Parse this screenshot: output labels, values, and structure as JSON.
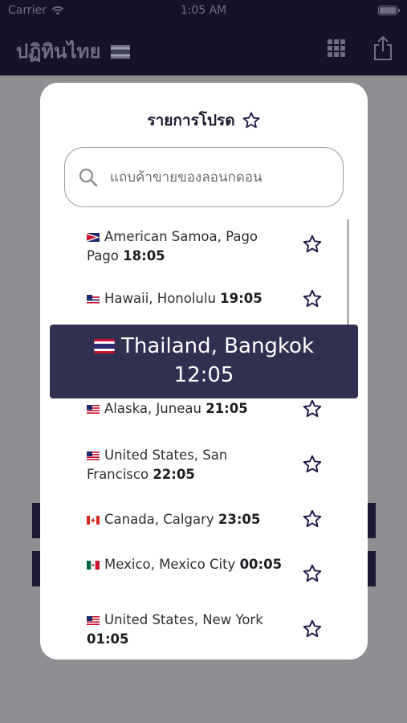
{
  "status_bar": {
    "carrier": "Carrier",
    "time": "1:05 AM"
  },
  "nav_bar": {
    "title": "ปฏิทินไทย"
  },
  "modal": {
    "title": "รายการโปรด",
    "search": {
      "placeholder": "แถบค้าขายของลอนกดอน",
      "value": ""
    },
    "items": [
      {
        "city": "American Samoa, Pago Pago",
        "time": "18:05",
        "flag": "american-samoa-flag"
      },
      {
        "city": "Hawaii, Honolulu",
        "time": "19:05",
        "flag": "hawaii-flag"
      },
      {
        "city": "Alaska, Juneau",
        "time": "21:05",
        "flag": "us-flag"
      },
      {
        "city": "United States, San Francisco",
        "time": "22:05",
        "flag": "us-flag"
      },
      {
        "city": "Canada, Calgary",
        "time": "23:05",
        "flag": "canada-flag"
      },
      {
        "city": "Mexico, Mexico City",
        "time": "00:05",
        "flag": "mexico-flag"
      },
      {
        "city": "United States, New York",
        "time": "01:05",
        "flag": "us-flag"
      }
    ]
  },
  "highlight": {
    "city": "Thailand, Bangkok",
    "time": "12:05",
    "flag": "thai-flag"
  },
  "colors": {
    "nav_background": "#14132a",
    "banner_background": "#313050",
    "accent": "#1b1a4a"
  }
}
